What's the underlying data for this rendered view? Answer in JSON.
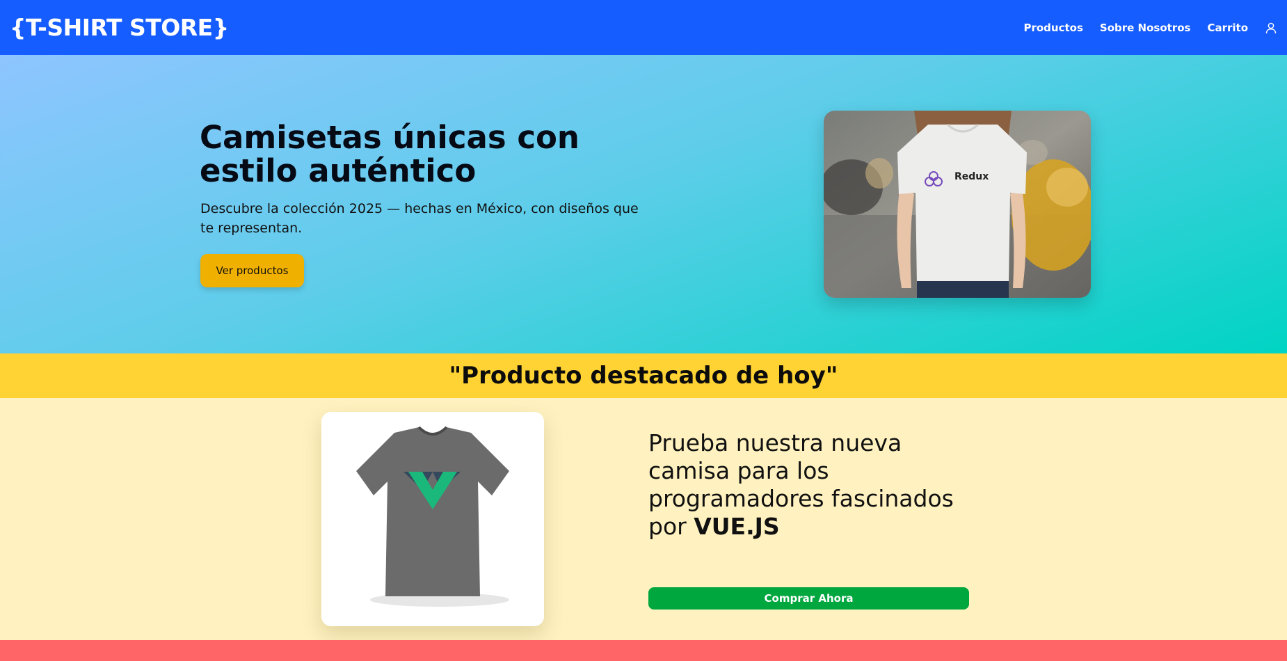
{
  "header": {
    "brand": "{T-SHIRT STORE}",
    "nav": [
      "Productos",
      "Sobre Nosotros",
      "Carrito"
    ],
    "user_icon": "user-icon"
  },
  "hero": {
    "title": "Camisetas únicas con estilo auténtico",
    "subtitle": "Descubre la colección 2025 — hechas en México, con diseños que te representan.",
    "cta": "Ver productos",
    "image_logo_text": "Redux"
  },
  "featured": {
    "heading": "\"Producto destacado de hoy\"",
    "description_prefix": "Prueba nuestra nueva camisa para los programadores fascinados por ",
    "description_brand": "VUE.JS",
    "cta": "Comprar Ahora"
  },
  "colors": {
    "navbar": "#165dff",
    "banner": "#ffd333",
    "featured_bg": "#fff2c0",
    "hero_button": "#f0b000",
    "buy_button": "#00a63e",
    "bottom_strip": "#ff6467"
  }
}
